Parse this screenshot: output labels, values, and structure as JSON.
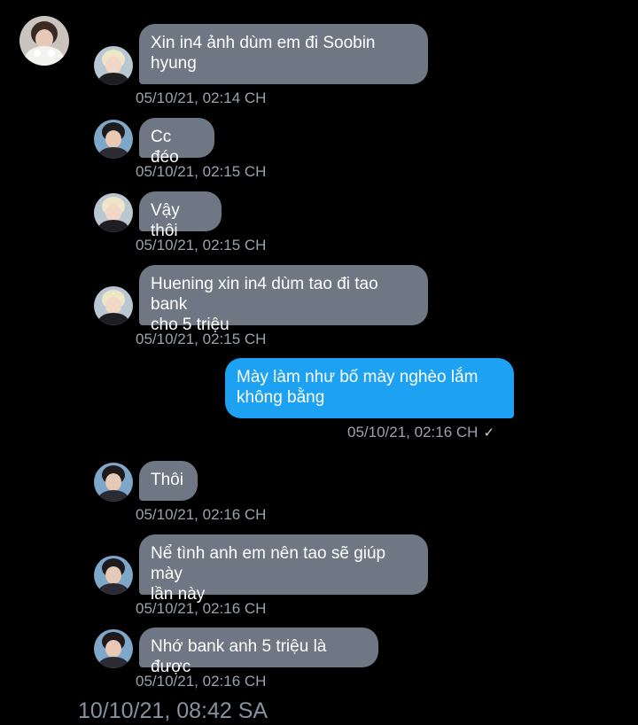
{
  "colors": {
    "background": "#000000",
    "received_bubble": "#6e7783",
    "sent_bubble": "#1da1f2",
    "timestamp": "#9aa3ad"
  },
  "conversation": {
    "messages": [
      {
        "direction": "received",
        "sender_avatar": "blonde-avatar",
        "text": "Xin in4 ảnh dùm em đi Soobin\nhyung",
        "time": "05/10/21, 02:14 CH"
      },
      {
        "direction": "received",
        "sender_avatar": "dark-hair-avatar",
        "text": "Cc đéo",
        "time": "05/10/21, 02:15 CH"
      },
      {
        "direction": "received",
        "sender_avatar": "blonde-avatar",
        "text": "Vậy thôi",
        "time": "05/10/21, 02:15 CH"
      },
      {
        "direction": "received",
        "sender_avatar": "blonde-avatar",
        "text": "Huening xin in4 dùm tao đi tao bank\ncho 5 triệu",
        "time": "05/10/21, 02:15 CH"
      },
      {
        "direction": "sent",
        "text": "Mày làm như bố mày nghèo lắm\nkhông bằng",
        "time": "05/10/21, 02:16 CH",
        "status_icon": "check-icon",
        "status_glyph": "✓"
      },
      {
        "direction": "received",
        "sender_avatar": "dark-hair-avatar",
        "text": "Thôi",
        "time": "05/10/21, 02:16 CH"
      },
      {
        "direction": "received",
        "sender_avatar": "dark-hair-avatar",
        "text": "Nể tình anh em nên tao sẽ giúp mày\nlần này",
        "time": "05/10/21, 02:16 CH"
      },
      {
        "direction": "received",
        "sender_avatar": "dark-hair-avatar",
        "text": "Nhớ bank anh 5 triệu là được",
        "time": "05/10/21, 02:16 CH"
      }
    ],
    "date_divider": "10/10/21, 08:42 SA"
  }
}
